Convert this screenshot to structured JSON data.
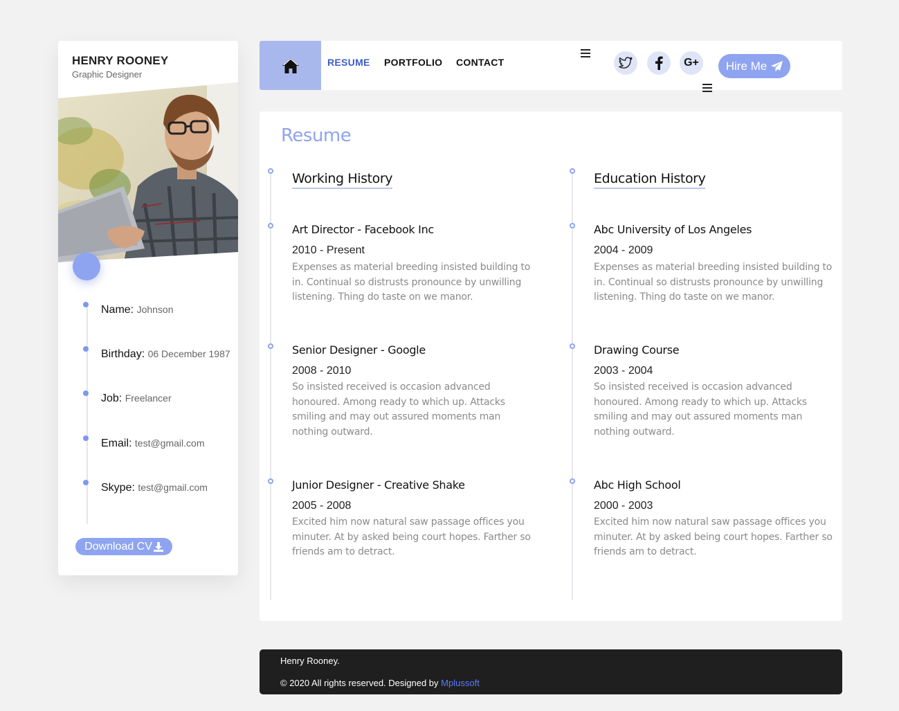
{
  "profile": {
    "name": "HENRY ROONEY",
    "title": "Graphic Designer",
    "info": [
      {
        "label": "Name:",
        "value": "Johnson"
      },
      {
        "label": "Birthday:",
        "value": "06 December 1987"
      },
      {
        "label": "Job:",
        "value": "Freelancer"
      },
      {
        "label": "Email:",
        "value": "test@gmail.com"
      },
      {
        "label": "Skype:",
        "value": "test@gmail.com"
      }
    ],
    "download_label": "Download CV"
  },
  "nav": {
    "links": [
      "RESUME",
      "PORTFOLIO",
      "CONTACT"
    ],
    "hire_label": "Hire Me",
    "social": [
      "twitter-icon",
      "facebook-icon",
      "google-plus-icon"
    ],
    "google_plus_text": "G+"
  },
  "resume": {
    "title": "Resume",
    "working": {
      "heading": "Working History",
      "entries": [
        {
          "title": "Art Director - Facebook Inc",
          "date": "2010 - Present",
          "desc": "Expenses as material breeding insisted building to in. Continual so distrusts pronounce by unwilling listening. Thing do taste on we manor."
        },
        {
          "title": "Senior Designer - Google",
          "date": "2008 - 2010",
          "desc": "So insisted received is occasion advanced honoured. Among ready to which up. Attacks smiling and may out assured moments man nothing outward."
        },
        {
          "title": "Junior Designer - Creative Shake",
          "date": "2005 - 2008",
          "desc": "Excited him now natural saw passage offices you minuter. At by asked being court hopes. Farther so friends am to detract."
        }
      ]
    },
    "education": {
      "heading": "Education History",
      "entries": [
        {
          "title": "Abc University of Los Angeles",
          "date": "2004 - 2009",
          "desc": "Expenses as material breeding insisted building to in. Continual so distrusts pronounce by unwilling listening. Thing do taste on we manor."
        },
        {
          "title": "Drawing Course",
          "date": "2003 - 2004",
          "desc": "So insisted received is occasion advanced honoured. Among ready to which up. Attacks smiling and may out assured moments man nothing outward."
        },
        {
          "title": "Abc High School",
          "date": "2000 - 2003",
          "desc": "Excited him now natural saw passage offices you minuter. At by asked being court hopes. Farther so friends am to detract."
        }
      ]
    }
  },
  "footer": {
    "name": "Henry Rooney.",
    "copyright": "© 2020 All rights reserved. Designed by",
    "link": "Mplussoft"
  },
  "colors": {
    "accent": "#8ea4f0",
    "home_bg": "#a9b8ec",
    "active_link": "#3f5bc8",
    "footer_bg": "#1f1f1f"
  }
}
